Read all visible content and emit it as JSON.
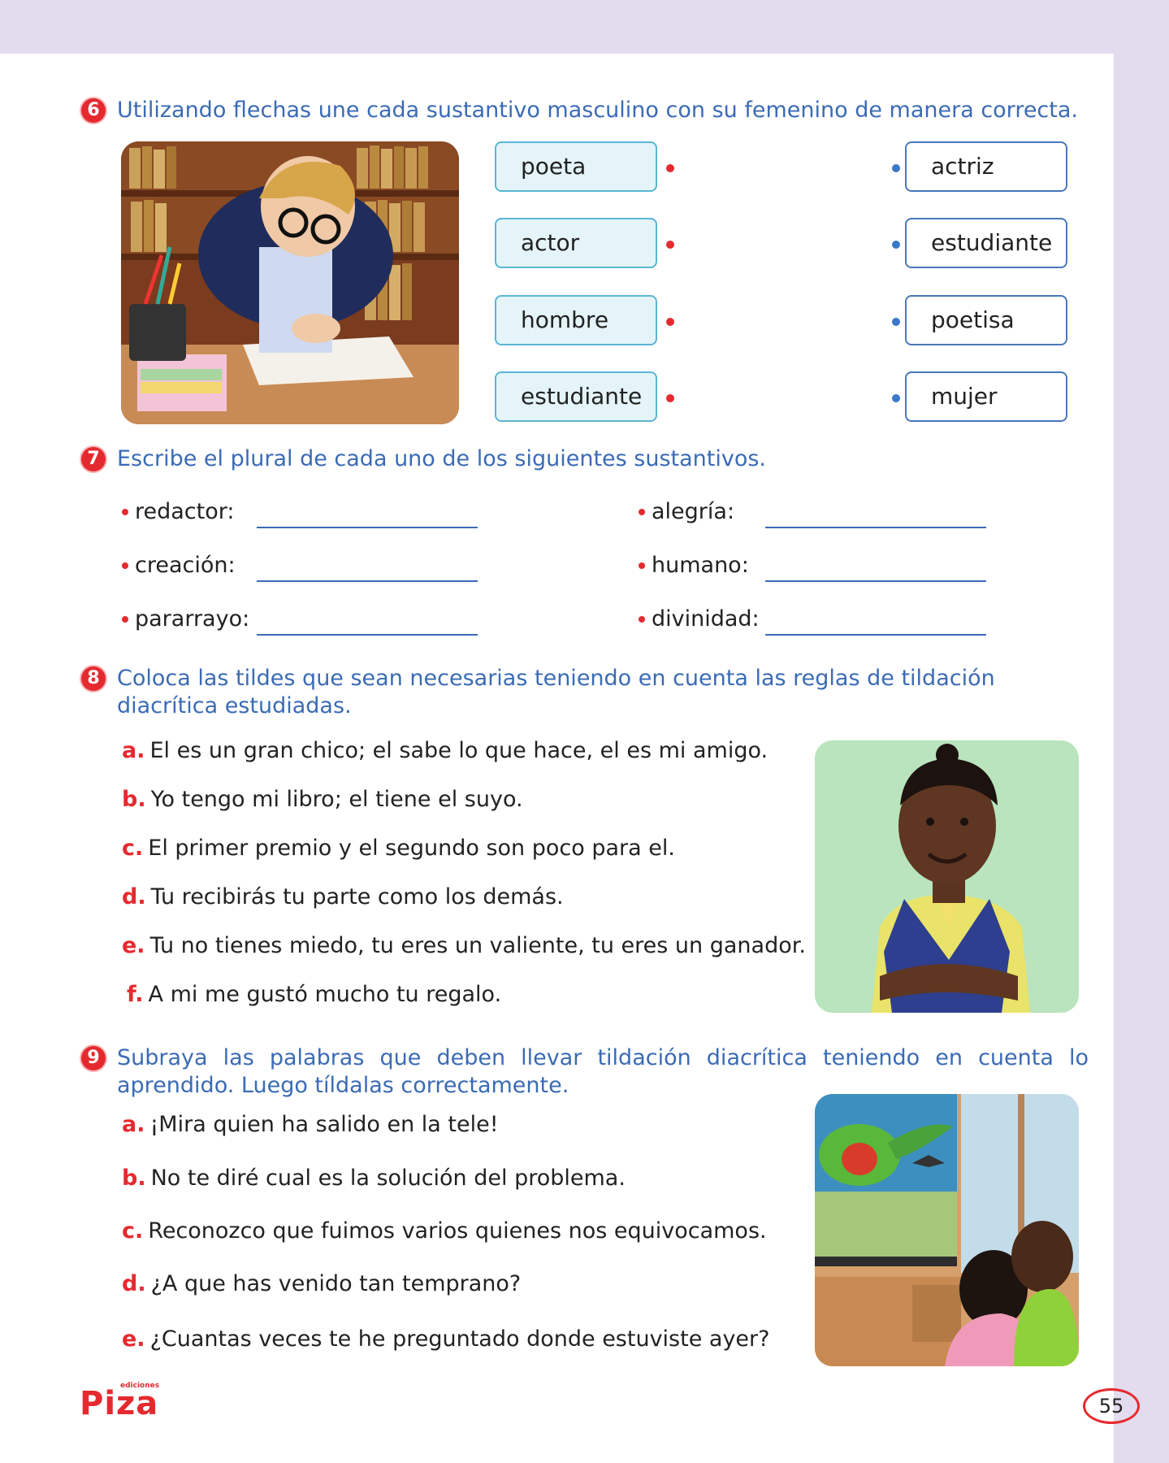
{
  "q6": {
    "number": "6",
    "instruction": "Utilizando flechas une cada sustantivo masculino con su femenino de manera correcta.",
    "left_words": [
      "poeta",
      "actor",
      "hombre",
      "estudiante"
    ],
    "right_words": [
      "actriz",
      "estudiante",
      "poetisa",
      "mujer"
    ],
    "colors": {
      "left_border": "#5ab6d4",
      "left_fill": "#e4f4f9",
      "right_border": "#4978b8",
      "left_dot": "#e52a2f",
      "right_dot": "#3a78c9"
    }
  },
  "q7": {
    "number": "7",
    "instruction": "Escribe el plural de cada uno de los siguientes sustantivos.",
    "items": [
      "redactor:",
      "creación:",
      "pararrayo:",
      "alegría:",
      "humano:",
      "divinidad:"
    ]
  },
  "q8": {
    "number": "8",
    "instruction": "Coloca las tildes que sean necesarias teniendo en cuenta las reglas de tildación diacrítica estudiadas.",
    "items": [
      {
        "letter": "a.",
        "text": "El es un gran chico; el sabe lo que hace, el es mi amigo."
      },
      {
        "letter": "b.",
        "text": "Yo tengo mi libro; el tiene el suyo."
      },
      {
        "letter": "c.",
        "text": "El primer premio y el segundo son poco para el."
      },
      {
        "letter": "d.",
        "text": "Tu recibirás tu parte como los demás."
      },
      {
        "letter": "e.",
        "text": "Tu no tienes miedo, tu eres un valiente, tu eres un ganador."
      },
      {
        "letter": "f.",
        "text": "A mi me gustó mucho tu regalo."
      }
    ]
  },
  "q9": {
    "number": "9",
    "instruction": "Subraya las palabras que deben llevar tildación diacrítica teniendo en cuenta lo aprendido. Luego tíldalas correctamente.",
    "items": [
      {
        "letter": "a.",
        "text": "¡Mira quien ha salido en la tele!"
      },
      {
        "letter": "b.",
        "text": "No te diré cual es la solución del problema."
      },
      {
        "letter": "c.",
        "text": "Reconozco que fuimos varios quienes nos equivocamos."
      },
      {
        "letter": "d.",
        "text": "¿A que has venido tan temprano?"
      },
      {
        "letter": "e.",
        "text": "¿Cuantas veces te he preguntado donde estuviste ayer?"
      }
    ]
  },
  "footer": {
    "logo_small": "ediciones",
    "logo_main": "Piza",
    "page_number": "55",
    "brand_color": "#e52a2f"
  },
  "theme": {
    "accent_blue": "#3b6bb5",
    "accent_red": "#e52a2f",
    "page_border": "#e3dbee"
  }
}
